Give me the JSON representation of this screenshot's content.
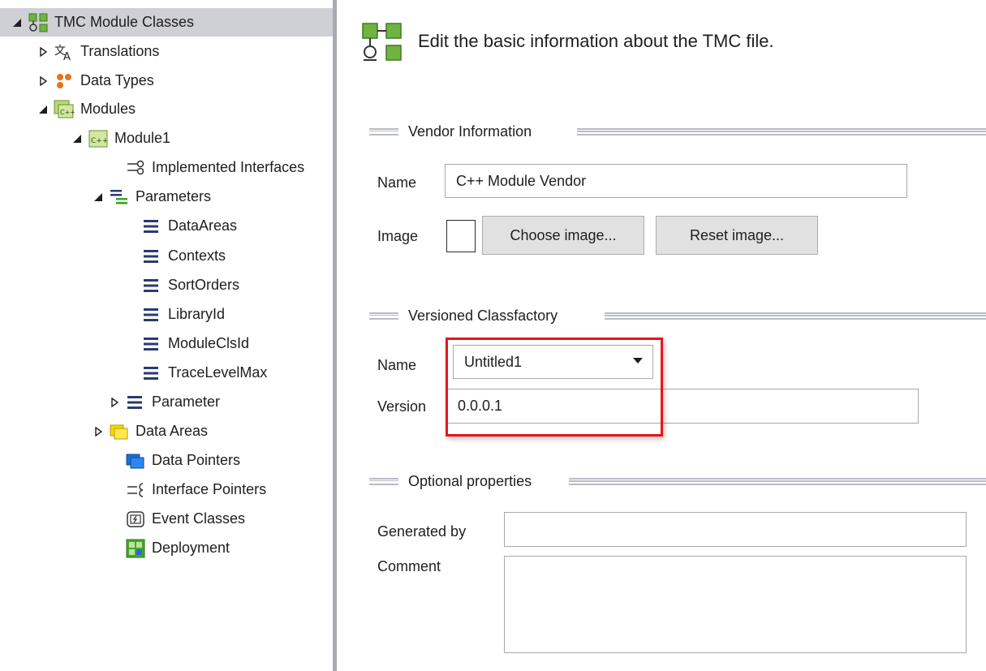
{
  "tree": {
    "root": {
      "label": "TMC Module Classes"
    },
    "translations": {
      "label": "Translations"
    },
    "data_types": {
      "label": "Data Types"
    },
    "modules": {
      "label": "Modules"
    },
    "module1": {
      "label": "Module1"
    },
    "implemented_interfaces": {
      "label": "Implemented Interfaces"
    },
    "parameters": {
      "label": "Parameters"
    },
    "parameter_items": [
      {
        "label": "DataAreas"
      },
      {
        "label": "Contexts"
      },
      {
        "label": "SortOrders"
      },
      {
        "label": "LibraryId"
      },
      {
        "label": "ModuleClsId"
      },
      {
        "label": "TraceLevelMax"
      }
    ],
    "parameter_node": {
      "label": "Parameter"
    },
    "data_areas": {
      "label": "Data Areas"
    },
    "data_pointers": {
      "label": "Data Pointers"
    },
    "interface_pointers": {
      "label": "Interface Pointers"
    },
    "event_classes": {
      "label": "Event Classes"
    },
    "deployment": {
      "label": "Deployment"
    }
  },
  "header": {
    "text": "Edit the basic information about the TMC file."
  },
  "vendor": {
    "title": "Vendor Information",
    "name_label": "Name",
    "name_value": "C++ Module Vendor",
    "image_label": "Image",
    "choose_image_button": "Choose image...",
    "reset_image_button": "Reset image..."
  },
  "classfactory": {
    "title": "Versioned Classfactory",
    "name_label": "Name",
    "name_selected": "Untitled1",
    "version_label": "Version",
    "version_value": "0.0.0.1"
  },
  "optional": {
    "title": "Optional properties",
    "generated_by_label": "Generated by",
    "generated_by_value": "",
    "comment_label": "Comment",
    "comment_value": ""
  },
  "colors": {
    "selection": "#cfcfd6",
    "highlight_border": "#e8141c",
    "splitter": "#a9abb3"
  }
}
